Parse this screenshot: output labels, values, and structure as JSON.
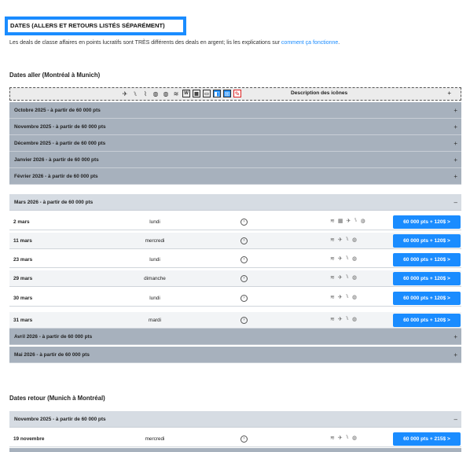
{
  "page_title": "DATES (ALLERS ET RETOURS LISTÉS SÉPARÉMENT)",
  "intro": {
    "text": "Les deals de classe affaires en points lucratifs sont TRÈS différents des deals en argent; lis les explications sur ",
    "link": "comment ça fonctionne",
    "end": "."
  },
  "outbound": {
    "title": "Dates aller (Montréal à Munich)",
    "legend_label": "Description des icônes",
    "legend_toggle": "+",
    "legend_icons": [
      "plane-icon",
      "seat-icon",
      "lie-flat-icon",
      "badge-icon",
      "badge2-icon",
      "wifi-icon",
      "w-box-icon",
      "calendar-icon",
      "screen-icon",
      "blue-square-icon",
      "blue-box-icon",
      "red-box-icon"
    ],
    "months": [
      {
        "label": "Octobre 2025 - à partir de 60 000 pts",
        "toggle": "+"
      },
      {
        "label": "Novembre 2025 - à partir de 60 000 pts",
        "toggle": "+"
      },
      {
        "label": "Décembre 2025 - à partir de 60 000 pts",
        "toggle": "+"
      },
      {
        "label": "Janvier 2026 - à partir de 60 000 pts",
        "toggle": "+"
      },
      {
        "label": "Février 2026 - à partir de 60 000 pts",
        "toggle": "+"
      },
      {
        "label": "Mars 2026 - à partir de 60 000 pts",
        "toggle": "–"
      }
    ],
    "rows": [
      {
        "date": "2 mars",
        "day": "lundi",
        "price": "60 000 pts + 120$ >"
      },
      {
        "date": "11 mars",
        "day": "mercredi",
        "price": "60 000 pts + 120$ >"
      },
      {
        "date": "23 mars",
        "day": "lundi",
        "price": "60 000 pts + 120$ >"
      },
      {
        "date": "29 mars",
        "day": "dimanche",
        "price": "60 000 pts + 120$ >"
      },
      {
        "date": "30 mars",
        "day": "lundi",
        "price": "60 000 pts + 120$ >"
      },
      {
        "date": "31 mars",
        "day": "mardi",
        "price": "60 000 pts + 120$ >"
      }
    ],
    "after_months": [
      {
        "label": "Avril 2026 - à partir de 60 000 pts",
        "toggle": "+"
      },
      {
        "label": "Mai 2026 - à partir de 60 000 pts",
        "toggle": "+"
      }
    ]
  },
  "return": {
    "title": "Dates retour (Munich à Montréal)",
    "months": [
      {
        "label": "Novembre 2025 - à partir de 60 000 pts",
        "toggle": "–"
      }
    ],
    "rows": [
      {
        "date": "19 novembre",
        "day": "mercredi",
        "price": "60 000 pts + 215$ >"
      }
    ]
  },
  "colors": {
    "accent": "#1a8cff",
    "month_bar": "#a7b1bd",
    "month_open": "#d6dce3"
  }
}
